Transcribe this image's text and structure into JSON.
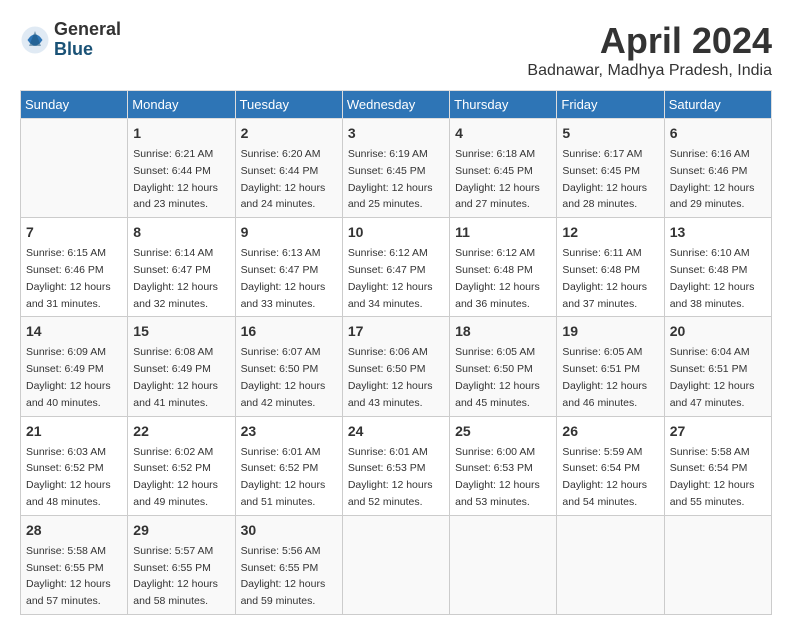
{
  "header": {
    "logo_general": "General",
    "logo_blue": "Blue",
    "month_title": "April 2024",
    "location": "Badnawar, Madhya Pradesh, India"
  },
  "calendar": {
    "days_of_week": [
      "Sunday",
      "Monday",
      "Tuesday",
      "Wednesday",
      "Thursday",
      "Friday",
      "Saturday"
    ],
    "weeks": [
      [
        {
          "day": "",
          "info": ""
        },
        {
          "day": "1",
          "info": "Sunrise: 6:21 AM\nSunset: 6:44 PM\nDaylight: 12 hours\nand 23 minutes."
        },
        {
          "day": "2",
          "info": "Sunrise: 6:20 AM\nSunset: 6:44 PM\nDaylight: 12 hours\nand 24 minutes."
        },
        {
          "day": "3",
          "info": "Sunrise: 6:19 AM\nSunset: 6:45 PM\nDaylight: 12 hours\nand 25 minutes."
        },
        {
          "day": "4",
          "info": "Sunrise: 6:18 AM\nSunset: 6:45 PM\nDaylight: 12 hours\nand 27 minutes."
        },
        {
          "day": "5",
          "info": "Sunrise: 6:17 AM\nSunset: 6:45 PM\nDaylight: 12 hours\nand 28 minutes."
        },
        {
          "day": "6",
          "info": "Sunrise: 6:16 AM\nSunset: 6:46 PM\nDaylight: 12 hours\nand 29 minutes."
        }
      ],
      [
        {
          "day": "7",
          "info": "Sunrise: 6:15 AM\nSunset: 6:46 PM\nDaylight: 12 hours\nand 31 minutes."
        },
        {
          "day": "8",
          "info": "Sunrise: 6:14 AM\nSunset: 6:47 PM\nDaylight: 12 hours\nand 32 minutes."
        },
        {
          "day": "9",
          "info": "Sunrise: 6:13 AM\nSunset: 6:47 PM\nDaylight: 12 hours\nand 33 minutes."
        },
        {
          "day": "10",
          "info": "Sunrise: 6:12 AM\nSunset: 6:47 PM\nDaylight: 12 hours\nand 34 minutes."
        },
        {
          "day": "11",
          "info": "Sunrise: 6:12 AM\nSunset: 6:48 PM\nDaylight: 12 hours\nand 36 minutes."
        },
        {
          "day": "12",
          "info": "Sunrise: 6:11 AM\nSunset: 6:48 PM\nDaylight: 12 hours\nand 37 minutes."
        },
        {
          "day": "13",
          "info": "Sunrise: 6:10 AM\nSunset: 6:48 PM\nDaylight: 12 hours\nand 38 minutes."
        }
      ],
      [
        {
          "day": "14",
          "info": "Sunrise: 6:09 AM\nSunset: 6:49 PM\nDaylight: 12 hours\nand 40 minutes."
        },
        {
          "day": "15",
          "info": "Sunrise: 6:08 AM\nSunset: 6:49 PM\nDaylight: 12 hours\nand 41 minutes."
        },
        {
          "day": "16",
          "info": "Sunrise: 6:07 AM\nSunset: 6:50 PM\nDaylight: 12 hours\nand 42 minutes."
        },
        {
          "day": "17",
          "info": "Sunrise: 6:06 AM\nSunset: 6:50 PM\nDaylight: 12 hours\nand 43 minutes."
        },
        {
          "day": "18",
          "info": "Sunrise: 6:05 AM\nSunset: 6:50 PM\nDaylight: 12 hours\nand 45 minutes."
        },
        {
          "day": "19",
          "info": "Sunrise: 6:05 AM\nSunset: 6:51 PM\nDaylight: 12 hours\nand 46 minutes."
        },
        {
          "day": "20",
          "info": "Sunrise: 6:04 AM\nSunset: 6:51 PM\nDaylight: 12 hours\nand 47 minutes."
        }
      ],
      [
        {
          "day": "21",
          "info": "Sunrise: 6:03 AM\nSunset: 6:52 PM\nDaylight: 12 hours\nand 48 minutes."
        },
        {
          "day": "22",
          "info": "Sunrise: 6:02 AM\nSunset: 6:52 PM\nDaylight: 12 hours\nand 49 minutes."
        },
        {
          "day": "23",
          "info": "Sunrise: 6:01 AM\nSunset: 6:52 PM\nDaylight: 12 hours\nand 51 minutes."
        },
        {
          "day": "24",
          "info": "Sunrise: 6:01 AM\nSunset: 6:53 PM\nDaylight: 12 hours\nand 52 minutes."
        },
        {
          "day": "25",
          "info": "Sunrise: 6:00 AM\nSunset: 6:53 PM\nDaylight: 12 hours\nand 53 minutes."
        },
        {
          "day": "26",
          "info": "Sunrise: 5:59 AM\nSunset: 6:54 PM\nDaylight: 12 hours\nand 54 minutes."
        },
        {
          "day": "27",
          "info": "Sunrise: 5:58 AM\nSunset: 6:54 PM\nDaylight: 12 hours\nand 55 minutes."
        }
      ],
      [
        {
          "day": "28",
          "info": "Sunrise: 5:58 AM\nSunset: 6:55 PM\nDaylight: 12 hours\nand 57 minutes."
        },
        {
          "day": "29",
          "info": "Sunrise: 5:57 AM\nSunset: 6:55 PM\nDaylight: 12 hours\nand 58 minutes."
        },
        {
          "day": "30",
          "info": "Sunrise: 5:56 AM\nSunset: 6:55 PM\nDaylight: 12 hours\nand 59 minutes."
        },
        {
          "day": "",
          "info": ""
        },
        {
          "day": "",
          "info": ""
        },
        {
          "day": "",
          "info": ""
        },
        {
          "day": "",
          "info": ""
        }
      ]
    ]
  }
}
